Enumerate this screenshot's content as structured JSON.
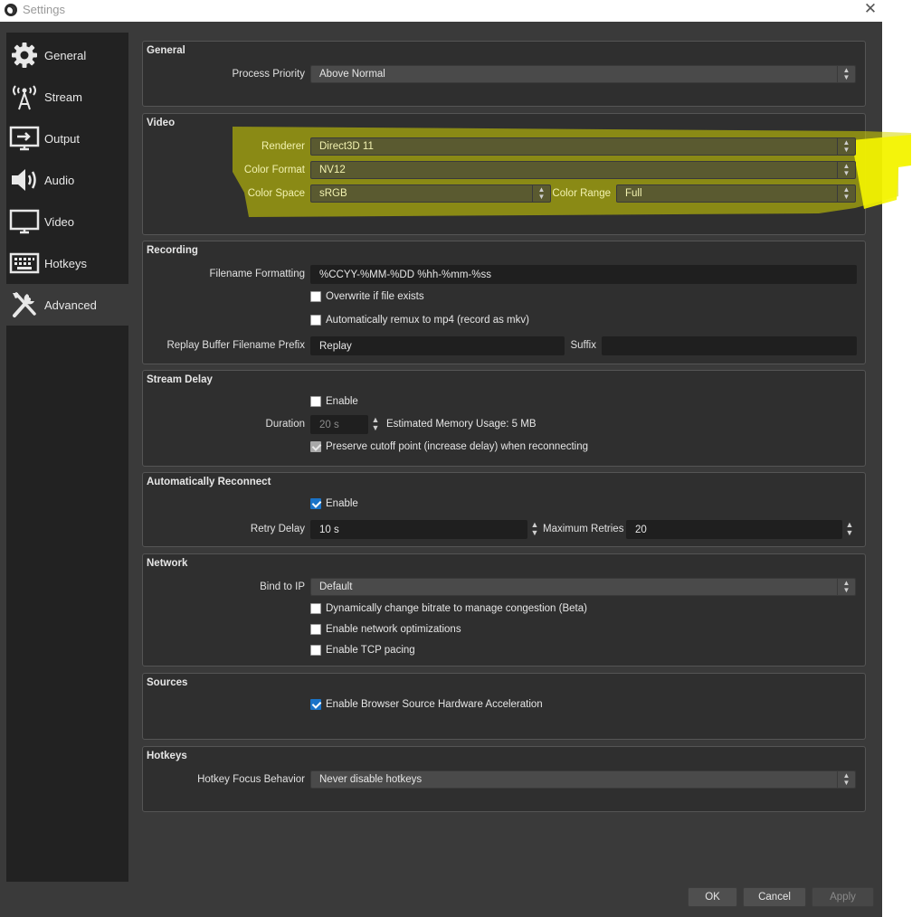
{
  "window": {
    "title": "Settings",
    "close_glyph": "✕"
  },
  "sidebar": {
    "items": [
      {
        "label": "General",
        "icon": "gear-icon"
      },
      {
        "label": "Stream",
        "icon": "broadcast-tower-icon"
      },
      {
        "label": "Output",
        "icon": "monitor-output-icon"
      },
      {
        "label": "Audio",
        "icon": "speaker-icon"
      },
      {
        "label": "Video",
        "icon": "monitor-icon"
      },
      {
        "label": "Hotkeys",
        "icon": "keyboard-icon"
      },
      {
        "label": "Advanced",
        "icon": "tools-icon",
        "active": true
      }
    ]
  },
  "general": {
    "title": "General",
    "process_priority_label": "Process Priority",
    "process_priority_value": "Above Normal"
  },
  "video": {
    "title": "Video",
    "renderer_label": "Renderer",
    "renderer_value": "Direct3D 11",
    "color_format_label": "Color Format",
    "color_format_value": "NV12",
    "color_space_label": "Color Space",
    "color_space_value": "sRGB",
    "color_range_label": "Color Range",
    "color_range_value": "Full",
    "highlight_color": "#f5f500"
  },
  "recording": {
    "title": "Recording",
    "filename_formatting_label": "Filename Formatting",
    "filename_formatting_value": "%CCYY-%MM-%DD %hh-%mm-%ss",
    "overwrite_label": "Overwrite if file exists",
    "overwrite_checked": false,
    "remux_label": "Automatically remux to mp4 (record as mkv)",
    "remux_checked": false,
    "replay_prefix_label": "Replay Buffer Filename Prefix",
    "replay_prefix_value": "Replay",
    "suffix_label": "Suffix",
    "suffix_value": ""
  },
  "stream_delay": {
    "title": "Stream Delay",
    "enable_label": "Enable",
    "enable_checked": false,
    "duration_label": "Duration",
    "duration_value": "20 s",
    "memory_usage": "Estimated Memory Usage: 5 MB",
    "preserve_label": "Preserve cutoff point (increase delay) when reconnecting",
    "preserve_checked": true
  },
  "reconnect": {
    "title": "Automatically Reconnect",
    "enable_label": "Enable",
    "enable_checked": true,
    "retry_delay_label": "Retry Delay",
    "retry_delay_value": "10 s",
    "max_retries_label": "Maximum Retries",
    "max_retries_value": "20"
  },
  "network": {
    "title": "Network",
    "bind_ip_label": "Bind to IP",
    "bind_ip_value": "Default",
    "dynamic_bitrate_label": "Dynamically change bitrate to manage congestion (Beta)",
    "network_opt_label": "Enable network optimizations",
    "tcp_pacing_label": "Enable TCP pacing"
  },
  "sources": {
    "title": "Sources",
    "browser_accel_label": "Enable Browser Source Hardware Acceleration",
    "browser_accel_checked": true
  },
  "hotkeys": {
    "title": "Hotkeys",
    "focus_behavior_label": "Hotkey Focus Behavior",
    "focus_behavior_value": "Never disable hotkeys"
  },
  "buttons": {
    "ok": "OK",
    "cancel": "Cancel",
    "apply": "Apply"
  }
}
